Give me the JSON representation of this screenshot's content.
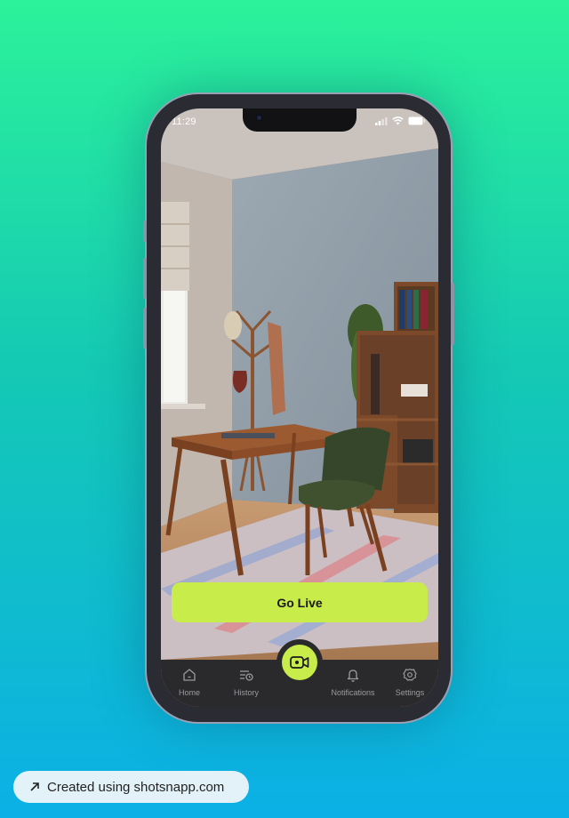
{
  "status_bar": {
    "time": "11:29"
  },
  "room_view": {
    "wall_color": "#8f9ba6",
    "floor_color": "#b8875f",
    "rug_color": "#c9bfc4"
  },
  "main": {
    "go_live_label": "Go Live"
  },
  "tab_bar": {
    "items": [
      {
        "label": "Home",
        "icon": "home-icon"
      },
      {
        "label": "History",
        "icon": "history-icon"
      },
      {
        "label": "Notifications",
        "icon": "bell-icon"
      },
      {
        "label": "Settings",
        "icon": "gear-icon"
      }
    ],
    "center_icon": "video-camera-icon"
  },
  "footer": {
    "credit_text": "Created using shotsnapp.com",
    "icon": "arrow-up-right-icon"
  },
  "colors": {
    "accent": "#c8ec4a",
    "tab_bar_bg": "#2a2a2d",
    "tab_label": "#9b9b9f"
  }
}
